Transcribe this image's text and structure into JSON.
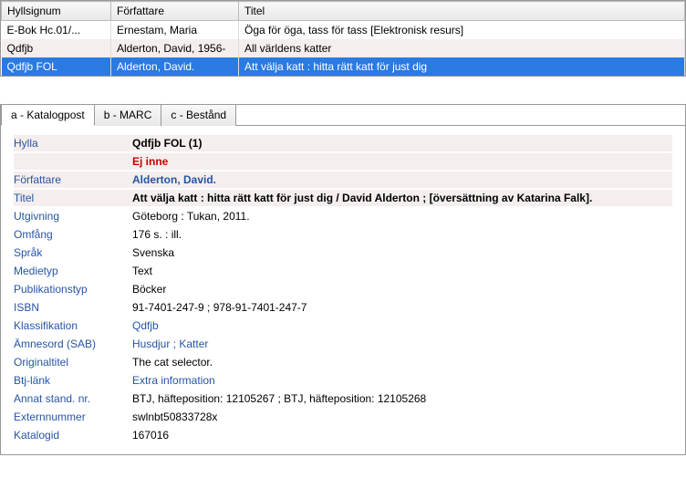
{
  "grid": {
    "headers": {
      "sig": "Hyllsignum",
      "auth": "Författare",
      "title": "Titel"
    },
    "rows": [
      {
        "sig": "E-Bok Hc.01/...",
        "auth": "Ernestam, Maria",
        "title": "Öga för öga, tass för tass [Elektronisk resurs]",
        "selected": false
      },
      {
        "sig": "Qdfjb",
        "auth": "Alderton, David, 1956-",
        "title": "All världens katter",
        "selected": false
      },
      {
        "sig": "Qdfjb FOL",
        "auth": "Alderton, David.",
        "title": "Att välja katt : hitta rätt katt för just dig",
        "selected": true
      }
    ]
  },
  "tabs": [
    {
      "label": "a - Katalogpost",
      "active": true
    },
    {
      "label": "b - MARC",
      "active": false
    },
    {
      "label": "c - Bestånd",
      "active": false
    }
  ],
  "details": {
    "hylla": {
      "label": "Hylla",
      "value": "Qdfjb FOL (1)",
      "status": "Ej inne"
    },
    "forfattare": {
      "label": "Författare",
      "value": "Alderton, David."
    },
    "titel": {
      "label": "Titel",
      "value": "Att välja katt : hitta rätt katt för just dig / David Alderton ; [översättning av Katarina Falk]."
    },
    "utgivning": {
      "label": "Utgivning",
      "value": "Göteborg : Tukan, 2011."
    },
    "omfang": {
      "label": "Omfång",
      "value": "176 s. : ill."
    },
    "sprak": {
      "label": "Språk",
      "value": "Svenska"
    },
    "medietyp": {
      "label": "Medietyp",
      "value": "Text"
    },
    "pubtyp": {
      "label": "Publikationstyp",
      "value": "Böcker"
    },
    "isbn": {
      "label": "ISBN",
      "value": "91-7401-247-9 ; 978-91-7401-247-7"
    },
    "klass": {
      "label": "Klassifikation",
      "value": "Qdfjb"
    },
    "amnesord": {
      "label": "Ämnesord (SAB)",
      "value": "Husdjur ; Katter"
    },
    "originaltitel": {
      "label": "Originaltitel",
      "value": "The cat selector."
    },
    "btjlank": {
      "label": "Btj-länk",
      "value": "Extra information"
    },
    "annatstd": {
      "label": "Annat stand. nr.",
      "value": "BTJ, häfteposition: 12105267 ; BTJ, häfteposition: 12105268"
    },
    "externnr": {
      "label": "Externnummer",
      "value": "swlnbt50833728x"
    },
    "katalogid": {
      "label": "Katalogid",
      "value": "167016"
    }
  }
}
